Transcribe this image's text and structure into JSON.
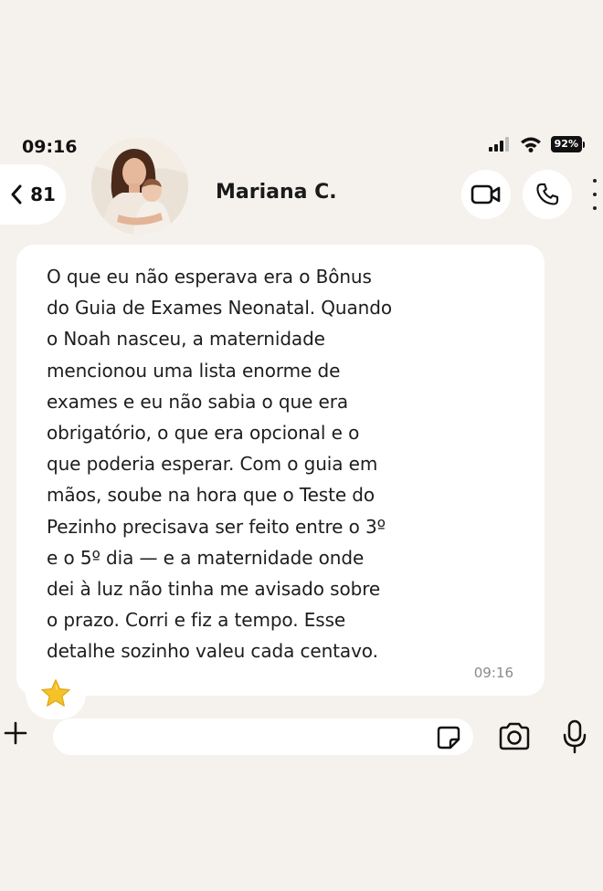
{
  "status_bar": {
    "time": "09:16",
    "battery": "92%"
  },
  "header": {
    "back_count": "81",
    "contact_name": "Mariana C.",
    "icons": {
      "back": "chevron-left-icon",
      "video": "video-camera-icon",
      "call": "phone-icon",
      "more": "more-vertical-icon"
    }
  },
  "message": {
    "text": "O que eu não esperava era o Bônus\ndo Guia de Exames Neonatal. Quando\no Noah nasceu, a maternidade\nmencionou uma lista enorme de\nexames e eu não sabia o que era\nobrigatório, o que era opcional e o\nque poderia esperar. Com o guia em\nmãos, soube na hora que o Teste do\nPezinho precisava ser feito entre o 3º\ne o 5º dia — e a maternidade onde\ndei à luz não tinha me avisado sobre\no prazo. Corri e fiz a tempo. Esse\ndetalhe sozinho valeu cada centavo.",
    "time": "09:16",
    "reaction": "star"
  },
  "composer": {
    "input_value": "",
    "icons": {
      "plus": "plus-icon",
      "sticker": "sticker-icon",
      "camera": "camera-icon",
      "mic": "microphone-icon"
    }
  },
  "colors": {
    "background": "#f5f2ed",
    "bubble": "#ffffff",
    "text": "#1d1d1d",
    "timestamp": "#8a8a8a",
    "star": "#f5c228"
  }
}
